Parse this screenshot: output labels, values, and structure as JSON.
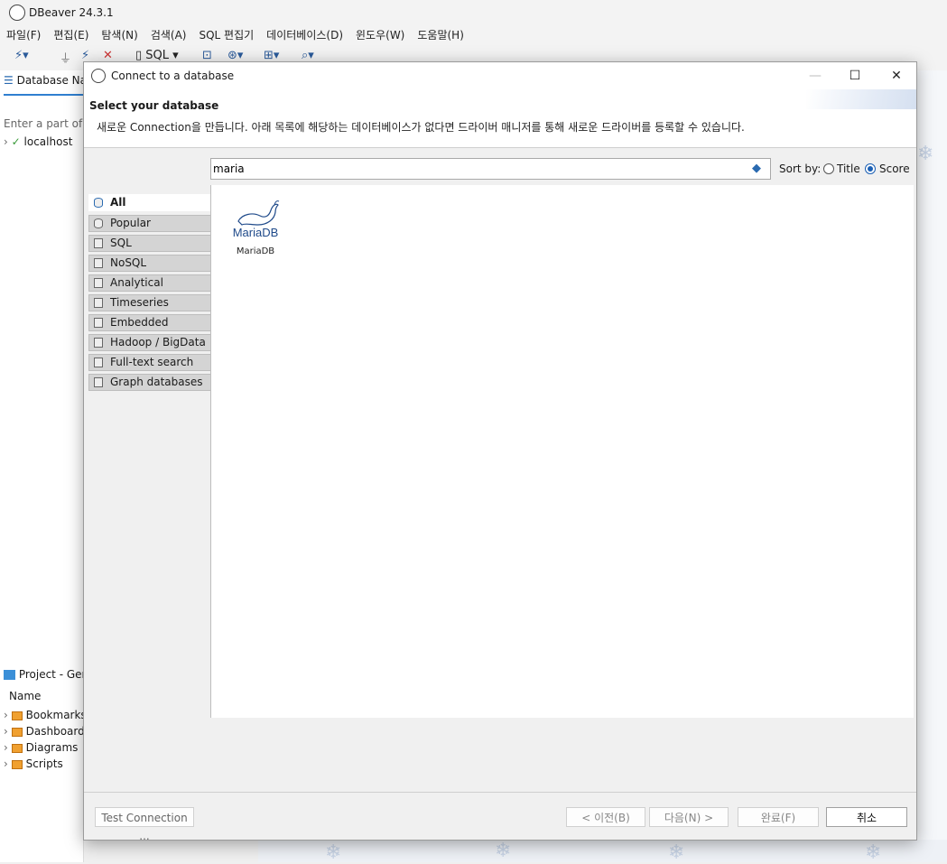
{
  "app": {
    "title": "DBeaver 24.3.1",
    "menu": [
      "파일(F)",
      "편집(E)",
      "탐색(N)",
      "검색(A)",
      "SQL 편집기",
      "데이터베이스(D)",
      "윈도우(W)",
      "도움말(H)"
    ],
    "toolbar": {
      "sql_label": "SQL"
    }
  },
  "navigator": {
    "tab_label": "Database Navigator",
    "filter_placeholder": "Enter a part of object name here",
    "items": [
      "localhost"
    ]
  },
  "project": {
    "tab_label": "Project - General",
    "column_name": "Name",
    "items": [
      "Bookmarks",
      "Dashboards",
      "Diagrams",
      "Scripts"
    ]
  },
  "dialog": {
    "title": "Connect to a database",
    "header_title": "Select your database",
    "header_desc": "새로운 Connection을 만듭니다. 아래 목록에 해당하는 데이터베이스가 없다면 드라이버 매니저를 통해 새로운 드라이버를 등록할 수 있습니다.",
    "search_value": "maria",
    "sort_label": "Sort by:",
    "sort_options": {
      "title": "Title",
      "score": "Score"
    },
    "sort_selected": "Score",
    "categories": [
      "All",
      "Popular",
      "SQL",
      "NoSQL",
      "Analytical",
      "Timeseries",
      "Embedded",
      "Hadoop / BigData",
      "Full-text search",
      "Graph databases"
    ],
    "selected_category": "All",
    "databases": [
      {
        "name": "MariaDB",
        "logo_text": "MariaDB"
      }
    ],
    "buttons": {
      "test": "Test Connection ...",
      "back": "< 이전(B)",
      "next": "다음(N) >",
      "finish": "완료(F)",
      "cancel": "취소"
    }
  },
  "colors": {
    "accent": "#1a5fb4",
    "logo_blue": "#1f4a8a"
  }
}
